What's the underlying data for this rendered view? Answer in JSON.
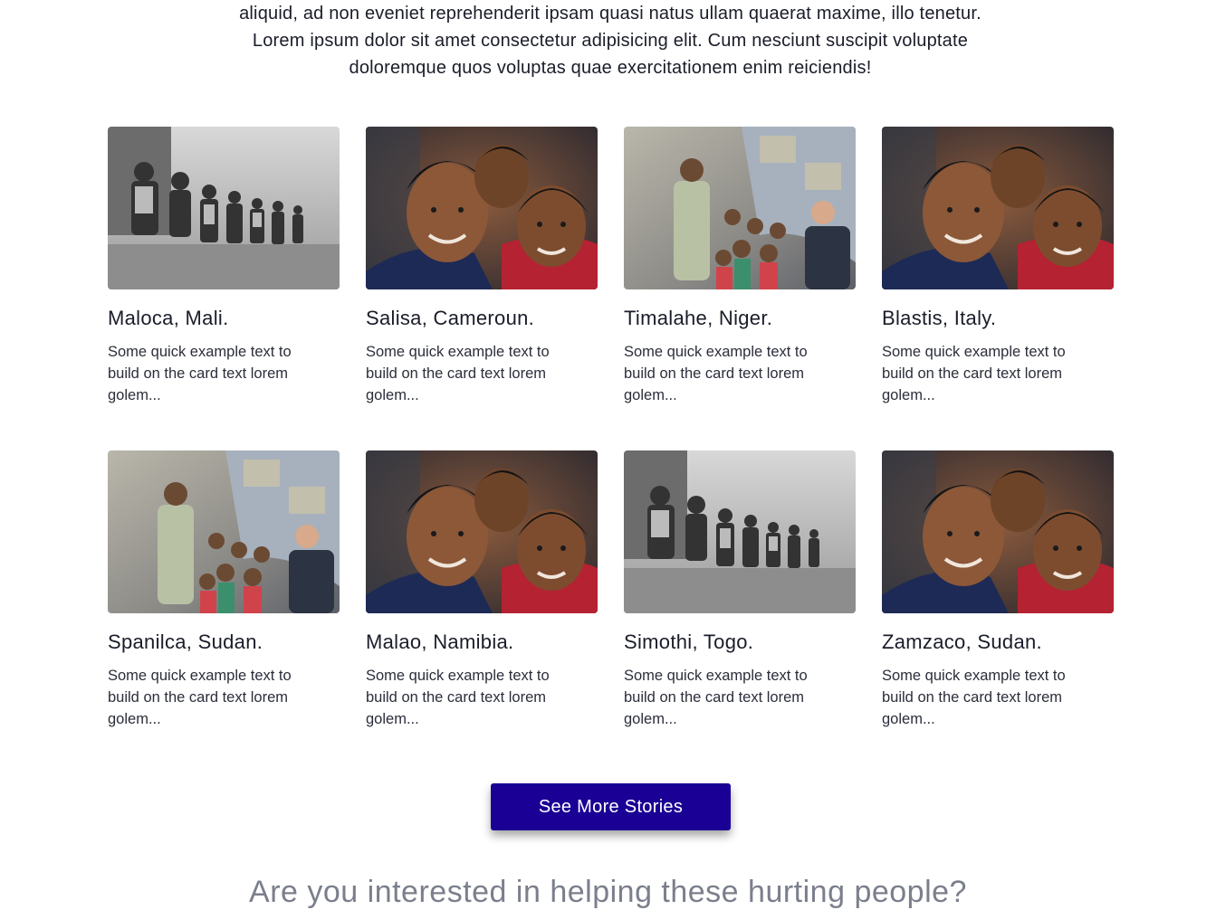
{
  "intro": {
    "line1": "aliquid, ad non eveniet reprehenderit ipsam quasi natus ullam quaerat maxime, illo tenetur.",
    "line2": "Lorem ipsum dolor sit amet consectetur adipisicing elit. Cum nesciunt suscipit voluptate",
    "line3": "doloremque quos voluptas quae exercitationem enim reiciendis!"
  },
  "stories": [
    {
      "title": "Maloca, Mali.",
      "text": "Some quick example text to build on the card text lorem golem...",
      "photo": "children-line-grayscale-photo"
    },
    {
      "title": "Salisa, Cameroun.",
      "text": "Some quick example text to build on the card text lorem golem...",
      "photo": "smiling-boys-photo"
    },
    {
      "title": "Timalahe, Niger.",
      "text": "Some quick example text to build on the card text lorem golem...",
      "photo": "volunteer-with-children-photo"
    },
    {
      "title": "Blastis, Italy.",
      "text": "Some quick example text to build on the card text lorem golem...",
      "photo": "smiling-boys-photo"
    },
    {
      "title": "Spanilca, Sudan.",
      "text": "Some quick example text to build on the card text lorem golem...",
      "photo": "volunteer-with-children-photo"
    },
    {
      "title": "Malao, Namibia.",
      "text": "Some quick example text to build on the card text lorem golem...",
      "photo": "smiling-boys-photo"
    },
    {
      "title": "Simothi, Togo.",
      "text": "Some quick example text to build on the card text lorem golem...",
      "photo": "children-line-grayscale-photo"
    },
    {
      "title": "Zamzaco, Sudan.",
      "text": "Some quick example text to build on the card text lorem golem...",
      "photo": "smiling-boys-photo"
    }
  ],
  "see_more": {
    "label": "See More Stories",
    "color": "#1a0094"
  },
  "next_section": {
    "heading": "Are you interested in helping these hurting people?"
  }
}
